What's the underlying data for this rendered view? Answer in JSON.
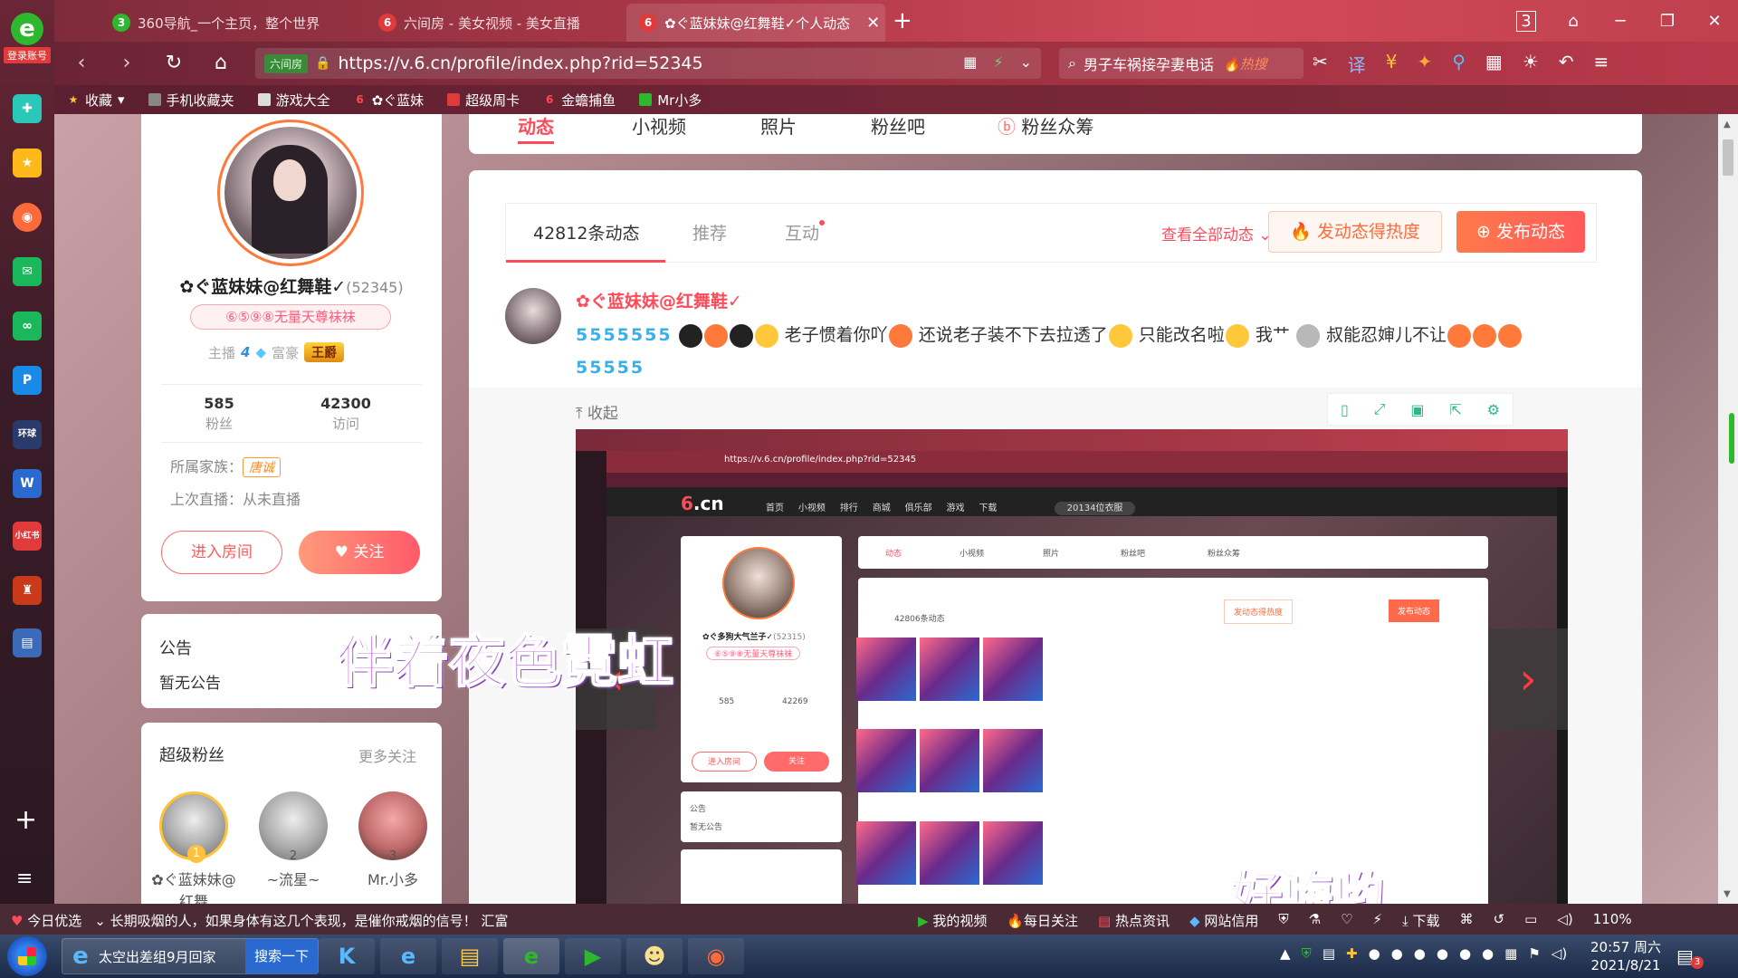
{
  "browser": {
    "tabs": [
      {
        "label": "360导航_一个主页，整个世界",
        "icon": "360"
      },
      {
        "label": "六间房 - 美女视频 - 美女直播",
        "icon": "6"
      },
      {
        "label": "✿ぐ蓝妹妹@红舞鞋✓个人动态",
        "icon": "6",
        "active": true
      }
    ],
    "tab_count": "3",
    "url": "https://v.6.cn/profile/index.php?rid=52345",
    "url_badge": "六间房",
    "search_text": "男子车祸接孕妻电话",
    "search_hot": "🔥热搜",
    "login_label": "登录账号",
    "bookmarks": [
      "收藏",
      "手机收藏夹",
      "游戏大全",
      "✿ぐ蓝妹",
      "超级周卡",
      "金蟾捕鱼",
      "Mr小多"
    ]
  },
  "profile": {
    "name": "✿ぐ蓝妹妹@红舞鞋✓",
    "rid": "(52345)",
    "label": "⑥⑤⑨⑧无量天尊袜袜",
    "host_label": "主播",
    "host_level": "4",
    "rich_label": "富豪",
    "rich_title": "王爵",
    "fans_count": "585",
    "fans_label": "粉丝",
    "visits_count": "42300",
    "visits_label": "访问",
    "family_label": "所属家族：",
    "family_name": "唐诚",
    "last_live": "上次直播：从未直播",
    "btn_room": "进入房间",
    "btn_follow": "关注"
  },
  "notice": {
    "title": "公告",
    "content": "暂无公告"
  },
  "super_fans": {
    "title": "超级粉丝",
    "more": "更多关注",
    "fans": [
      {
        "rank": "1",
        "name": "✿ぐ蓝妹妹@红舞"
      },
      {
        "rank": "2",
        "name": "~流星~"
      },
      {
        "rank": "3",
        "name": "Mr.小多"
      }
    ]
  },
  "profile_tabs": [
    "动态",
    "小视频",
    "照片",
    "粉丝吧",
    "粉丝众筹"
  ],
  "feed": {
    "tabs": [
      "42812条动态",
      "推荐",
      "互动"
    ],
    "view_all": "查看全部动态",
    "hot_btn": "发动态得热度",
    "publish_btn": "发布动态",
    "post": {
      "author": "✿ぐ蓝妹妹@红舞鞋✓",
      "text_1": "老子惯着你吖",
      "text_2": "还说老子装不下去拉透了",
      "text_3": "只能改名啦",
      "text_4": "我艹",
      "text_5": "叔能忍婶儿不让",
      "v_row": "5555555",
      "v_row2": "55555"
    },
    "collapse": "收起"
  },
  "inner_shot": {
    "url": "https://v.6.cn/profile/index.php?rid=52345",
    "name": "✿ぐ多狗大气兰子✓",
    "rid": "(52315)",
    "label": "⑥⑤⑨⑧无量天尊袜袜",
    "fans": "585",
    "visits": "42269",
    "feed_count": "42806条动态",
    "nav": [
      "首页",
      "小视频",
      "排行",
      "商城",
      "俱乐部",
      "游戏",
      "下载"
    ],
    "search": "20134位衣服",
    "tabs": [
      "动态",
      "小视频",
      "照片",
      "粉丝吧",
      "粉丝众筹"
    ],
    "notice": "公告",
    "notice_content": "暂无公告",
    "btn_room": "进入房间",
    "btn_follow": "关注",
    "hot_btn": "发动态得热度",
    "pub_btn": "发布动态"
  },
  "overlays": {
    "text1": "伴着夜色霓虹",
    "text2": "好嗨哟"
  },
  "statusbar": {
    "left": [
      "今日优选",
      "长期吸烟的人，如果身体有这几个表现，是催你戒烟的信号！",
      "汇富"
    ],
    "right": [
      "我的视频",
      "每日关注",
      "热点资讯",
      "网站信用",
      "下载",
      "110%"
    ]
  },
  "taskbar": {
    "task_label": "太空出差组9月回家",
    "search_btn": "搜索一下",
    "time": "20:57 周六",
    "date": "2021/8/21",
    "notif_count": "3"
  },
  "colors": {
    "accent": "#ff4a5a",
    "chrome": "#b23a4a"
  }
}
